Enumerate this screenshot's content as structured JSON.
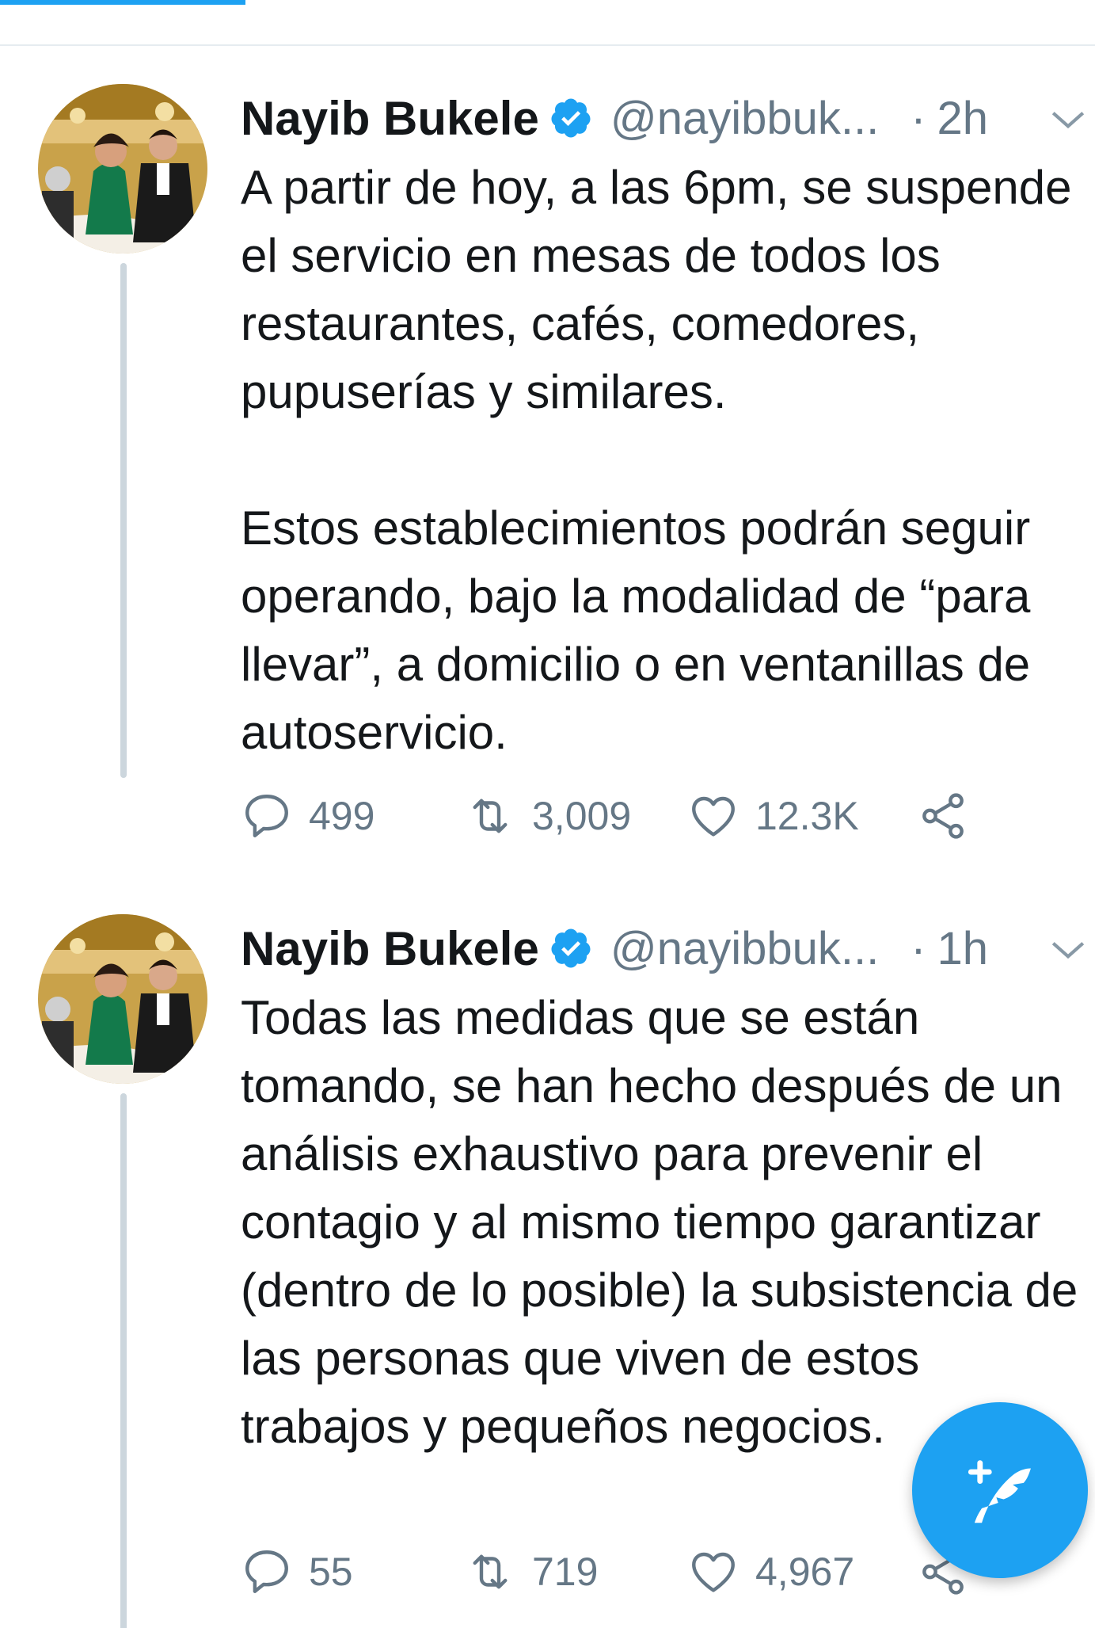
{
  "colors": {
    "accent": "#1da1f2",
    "text": "#14171a",
    "secondary": "#657786",
    "thread_line": "#ccd6dd"
  },
  "tweets": [
    {
      "author_name": "Nayib Bukele",
      "handle": "@nayibbuk...",
      "separator": "·",
      "time": "2h",
      "verified": true,
      "paragraphs": [
        "A partir de hoy, a las 6pm, se suspende el servicio en mesas de todos los restaurantes, cafés, comedores, pupuserías y similares.",
        "Estos establecimientos podrán seguir operando, bajo la modalidad de “para llevar”, a domicilio o en ventanillas de autoservicio."
      ],
      "replies": "499",
      "retweets": "3,009",
      "likes": "12.3K"
    },
    {
      "author_name": "Nayib Bukele",
      "handle": "@nayibbuk...",
      "separator": "·",
      "time": "1h",
      "verified": true,
      "paragraphs": [
        "Todas las medidas que se están tomando, se han hecho después de un análisis exhaustivo para prevenir el contagio y al mismo tiempo garantizar (dentro de lo posible) la subsistencia de las personas que viven de estos trabajos y pequeños negocios."
      ],
      "replies": "55",
      "retweets": "719",
      "likes": "4,967"
    }
  ],
  "icons": {
    "reply": "reply-icon",
    "retweet": "retweet-icon",
    "like": "heart-icon",
    "share": "share-icon",
    "verified": "verified-badge-icon",
    "more": "chevron-down-icon",
    "compose": "compose-tweet-icon"
  }
}
